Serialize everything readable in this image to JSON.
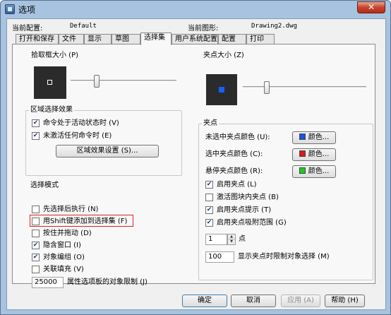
{
  "window": {
    "title": "选项",
    "close_glyph": "✕",
    "app_icon": "app-icon"
  },
  "header": {
    "current_profile_label": "当前配置:",
    "current_profile_value": "Default",
    "current_drawing_label": "当前图形:",
    "current_drawing_value": "Drawing2.dwg"
  },
  "tabs": [
    {
      "label": "打开和保存",
      "active": false
    },
    {
      "label": "文件",
      "active": false
    },
    {
      "label": "显示",
      "active": false
    },
    {
      "label": "草图",
      "active": false
    },
    {
      "label": "选择集",
      "active": true
    },
    {
      "label": "用户系统配置",
      "active": false
    },
    {
      "label": "配置",
      "active": false
    },
    {
      "label": "打印",
      "active": false
    }
  ],
  "pickbox": {
    "title": "拾取框大小 (P)",
    "slider_level": 0.23
  },
  "grip_size": {
    "title": "夹点大小 (Z)",
    "slider_level": 0.18,
    "grip_color": "#1560ff"
  },
  "area_selection": {
    "title": "区域选择效果",
    "items": [
      {
        "label": "命令处于活动状态时 (V)",
        "checked": true
      },
      {
        "label": "未激活任何命令时 (E)",
        "checked": true
      }
    ],
    "settings_button": "区域效果设置 (S)..."
  },
  "selection_modes": {
    "title": "选择模式",
    "items": [
      {
        "label": "先选择后执行 (N)",
        "checked": false
      },
      {
        "label": "用Shift键添加到选择集 (F)",
        "checked": false
      },
      {
        "label": "按住并拖动 (D)",
        "checked": false
      },
      {
        "label": "隐含窗口 (I)",
        "checked": true
      },
      {
        "label": "对象编组 (O)",
        "checked": true
      },
      {
        "label": "关联填充 (V)",
        "checked": false
      }
    ],
    "limit_value": "25000",
    "limit_label": "属性选项板的对象限制 (J)"
  },
  "grips": {
    "title": "夹点",
    "colors": [
      {
        "label": "未选中夹点颜色 (U):",
        "button": "颜色...",
        "swatch": "#1556e8"
      },
      {
        "label": "选中夹点颜色 (C):",
        "button": "颜色...",
        "swatch": "#e01818"
      },
      {
        "label": "悬停夹点颜色 (R):",
        "button": "颜色...",
        "swatch": "#18d018"
      }
    ],
    "checks": [
      {
        "label": "启用夹点 (L)",
        "checked": true
      },
      {
        "label": "激活图块内夹点 (B)",
        "checked": false
      },
      {
        "label": "启用夹点提示 (T)",
        "checked": true
      },
      {
        "label": "启用夹点吸附范围 (G)",
        "checked": true
      }
    ],
    "spinner_value": "1",
    "spinner_label": "点",
    "display_limit_value": "100",
    "display_limit_label": "显示夹点时限制对象选择 (M)"
  },
  "footer": {
    "ok": "确定",
    "cancel": "取消",
    "apply": "应用 (A)",
    "help": "帮助 (H)"
  },
  "check_glyph": "✔",
  "spin_up_glyph": "▲",
  "spin_down_glyph": "▼"
}
